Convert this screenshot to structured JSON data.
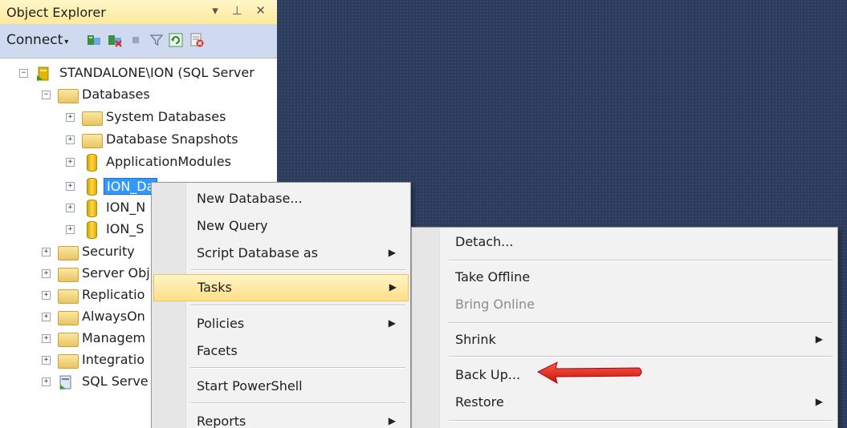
{
  "object_explorer": {
    "title": "Object Explorer",
    "title_controls": "▾ ⊥ ✕",
    "toolbar": {
      "connect_label": "Connect",
      "connect_arrow": "▾"
    },
    "tree": [
      {
        "label": "STANDALONE\\ION (SQL Server",
        "expander": "−",
        "icon": "server-icon"
      },
      {
        "label": "Databases",
        "expander": "−",
        "icon": "folder-icon"
      },
      {
        "label": "System Databases",
        "expander": "+",
        "icon": "folder-icon"
      },
      {
        "label": "Database Snapshots",
        "expander": "+",
        "icon": "folder-icon"
      },
      {
        "label": "ApplicationModules",
        "expander": "+",
        "icon": "database-icon"
      },
      {
        "label": "ION_Da",
        "expander": "+",
        "icon": "database-icon",
        "selected": true
      },
      {
        "label": "ION_N",
        "expander": "+",
        "icon": "database-icon"
      },
      {
        "label": "ION_S",
        "expander": "+",
        "icon": "database-icon"
      },
      {
        "label": "Security",
        "expander": "+",
        "icon": "folder-icon"
      },
      {
        "label": "Server Obj",
        "expander": "+",
        "icon": "folder-icon"
      },
      {
        "label": "Replicatio",
        "expander": "+",
        "icon": "folder-icon"
      },
      {
        "label": "AlwaysOn",
        "expander": "+",
        "icon": "folder-icon"
      },
      {
        "label": "Managem",
        "expander": "+",
        "icon": "folder-icon"
      },
      {
        "label": "Integratio",
        "expander": "+",
        "icon": "folder-icon"
      },
      {
        "label": "SQL Serve",
        "expander": "+",
        "icon": "agent-icon"
      }
    ]
  },
  "context_menu": {
    "items": [
      {
        "label": "New Database..."
      },
      {
        "label": "New Query"
      },
      {
        "label": "Script Database as",
        "submenu": "▶"
      },
      {
        "label": "Tasks",
        "submenu": "▶",
        "highlighted": true
      },
      {
        "label": "Policies",
        "submenu": "▶"
      },
      {
        "label": "Facets"
      },
      {
        "label": "Start PowerShell"
      },
      {
        "label": "Reports",
        "submenu": "▶"
      }
    ]
  },
  "tasks_submenu": {
    "items": [
      {
        "label": "Detach..."
      },
      {
        "label": "Take Offline"
      },
      {
        "label": "Bring Online",
        "disabled": true
      },
      {
        "label": "Shrink",
        "submenu": "▶"
      },
      {
        "label": "Back Up..."
      },
      {
        "label": "Restore",
        "submenu": "▶"
      }
    ]
  },
  "colors": {
    "workspace_bg": "#2b3c5c",
    "highlight": "#ffe08a",
    "selection": "#3399ff",
    "arrow": "#e4211c"
  }
}
